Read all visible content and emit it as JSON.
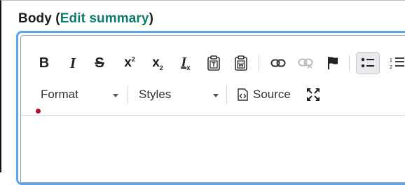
{
  "heading": {
    "label": "Body",
    "open_paren": " (",
    "link": "Edit summary",
    "close_paren": ")"
  },
  "toolbar": {
    "buttons": [
      {
        "name": "bold",
        "glyph": "B"
      },
      {
        "name": "italic",
        "glyph": "I"
      },
      {
        "name": "strikethrough",
        "glyph": "S"
      },
      {
        "name": "superscript",
        "glyph": "x",
        "sub": "2"
      },
      {
        "name": "subscript",
        "glyph": "x",
        "sub": "2"
      },
      {
        "name": "remove-format",
        "glyph": "I",
        "sub": "x"
      },
      {
        "name": "paste-as-text",
        "glyph": "T"
      },
      {
        "name": "paste-from-word",
        "glyph": "W"
      },
      {
        "name": "link"
      },
      {
        "name": "unlink"
      },
      {
        "name": "anchor"
      },
      {
        "name": "bulleted-list",
        "active": true
      },
      {
        "name": "numbered-list"
      }
    ],
    "format_label": "Format",
    "styles_label": "Styles",
    "source_label": "Source"
  },
  "colors": {
    "link": "#0f7b6c",
    "focus_border": "#5aa3ee",
    "bullet": "#b0102c"
  }
}
